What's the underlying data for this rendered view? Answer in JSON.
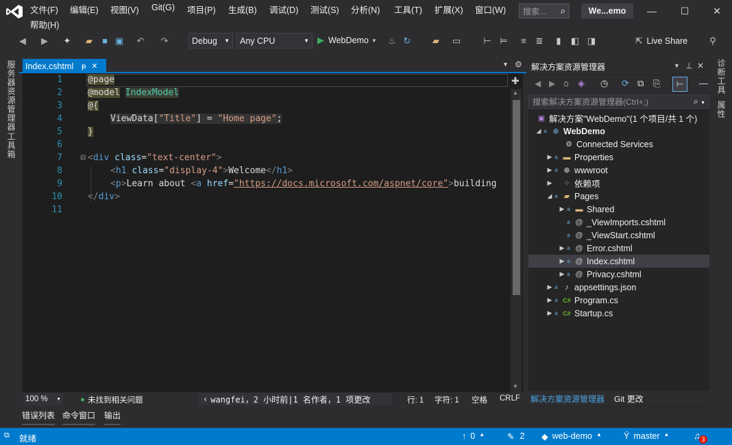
{
  "menu": {
    "items": [
      "文件(F)",
      "编辑(E)",
      "视图(V)",
      "Git(G)",
      "项目(P)",
      "生成(B)",
      "调试(D)",
      "测试(S)",
      "分析(N)",
      "工具(T)",
      "扩展(X)",
      "窗口(W)",
      "帮助(H)"
    ],
    "search_placeholder": "搜索...",
    "solution_name": "We...emo"
  },
  "toolbar": {
    "config": "Debug",
    "platform": "Any CPU",
    "run_target": "WebDemo",
    "live_share": "Live Share"
  },
  "left_panel": {
    "server_explorer": "服务器资源管理器",
    "toolbox": "工具箱"
  },
  "right_panel": {
    "diagnostics": "诊断工具",
    "properties": "属性"
  },
  "editor": {
    "tab_label": "Index.cshtml",
    "pin_glyph": "ᵽ",
    "line_numbers": [
      "1",
      "2",
      "3",
      "4",
      "5",
      "6",
      "7",
      "8",
      "9",
      "10",
      "11"
    ],
    "code": {
      "l1": "@page",
      "l2_a": "@model",
      "l2_b": "IndexModel",
      "l3": "@{",
      "l4_a": "ViewData[",
      "l4_b": "\"Title\"",
      "l4_c": "] = ",
      "l4_d": "\"Home page\"",
      "l4_e": ";",
      "l5": "}",
      "l7_a": "<",
      "l7_b": "div",
      "l7_c": "class",
      "l7_d": "=",
      "l7_e": "\"text-center\"",
      "l7_f": ">",
      "l8_b": "h1",
      "l8_c": "class",
      "l8_e": "\"display-4\"",
      "l8_g": "Welcome",
      "l8_h": "</",
      "l8_i": "h1",
      "l9_b": "p",
      "l9_g": "Learn about ",
      "l9_a": "a",
      "l9_c": "href",
      "l9_e": "\"https://docs.microsoft.com/aspnet/core\"",
      "l9_h": "building",
      "l10_a": "</",
      "l10_b": "div"
    },
    "zoom": "100 %",
    "issues": "未找到相关问题",
    "git_blame": "wangfei，2 小时前|1 名作者，1 项更改",
    "line": "行: 1",
    "col": "字符: 1",
    "spaces": "空格",
    "eol": "CRLF"
  },
  "bottom_tabs": [
    "错误列表",
    "命令窗口",
    "输出"
  ],
  "solution_explorer": {
    "title": "解决方案资源管理器",
    "search_placeholder": "搜索解决方案资源管理器(Ctrl+;)",
    "tree": [
      {
        "label": "解决方案\"WebDemo\"(1 个项目/共 1 个)",
        "icon": "solution-icon"
      },
      {
        "label": "WebDemo",
        "icon": "web-project-icon"
      },
      {
        "label": "Connected Services",
        "icon": "connected-services-icon"
      },
      {
        "label": "Properties",
        "icon": "folder-icon"
      },
      {
        "label": "wwwroot",
        "icon": "globe-icon"
      },
      {
        "label": "依赖项",
        "icon": "dependencies-icon"
      },
      {
        "label": "Pages",
        "icon": "folder-open-icon"
      },
      {
        "label": "Shared",
        "icon": "folder-icon"
      },
      {
        "label": "_ViewImports.cshtml",
        "icon": "razor-file-icon"
      },
      {
        "label": "_ViewStart.cshtml",
        "icon": "razor-file-icon"
      },
      {
        "label": "Error.cshtml",
        "icon": "razor-file-icon"
      },
      {
        "label": "Index.cshtml",
        "icon": "razor-file-icon"
      },
      {
        "label": "Privacy.cshtml",
        "icon": "razor-file-icon"
      },
      {
        "label": "appsettings.json",
        "icon": "json-file-icon"
      },
      {
        "label": "Program.cs",
        "icon": "csharp-file-icon"
      },
      {
        "label": "Startup.cs",
        "icon": "csharp-file-icon"
      }
    ],
    "tab_active": "解决方案资源管理器",
    "tab_git": "Git 更改"
  },
  "statusbar": {
    "ready": "就绪",
    "push_count": "0",
    "pending_changes": "2",
    "repo": "web-demo",
    "branch": "master",
    "notifications": "3"
  },
  "colors": {
    "accent": "#007acc",
    "bg": "#2d2d30",
    "editor_bg": "#1e1e1e"
  }
}
